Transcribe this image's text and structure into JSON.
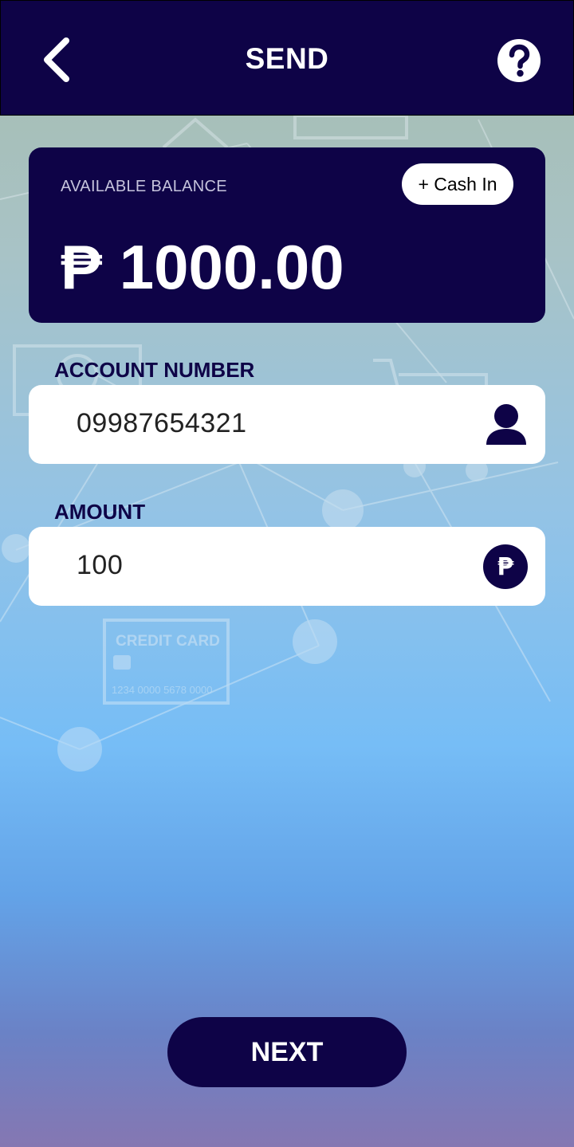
{
  "header": {
    "title": "SEND"
  },
  "balance": {
    "label": "AVAILABLE BALANCE",
    "currency_symbol": "₱",
    "amount": "1000.00",
    "cash_in_label": "+ Cash In"
  },
  "account": {
    "label": "ACCOUNT NUMBER",
    "value": "09987654321"
  },
  "amount": {
    "label": "AMOUNT",
    "value": "100"
  },
  "actions": {
    "next_label": "NEXT"
  },
  "background_art": {
    "card_text": "CREDIT CARD",
    "card_number": "1234 0000 5678 0000"
  },
  "icons": {
    "back": "chevron-left-icon",
    "help": "question-circle-icon",
    "contact": "person-icon",
    "currency": "peso-icon"
  },
  "colors": {
    "primary": "#0e0347",
    "surface": "#ffffff"
  }
}
